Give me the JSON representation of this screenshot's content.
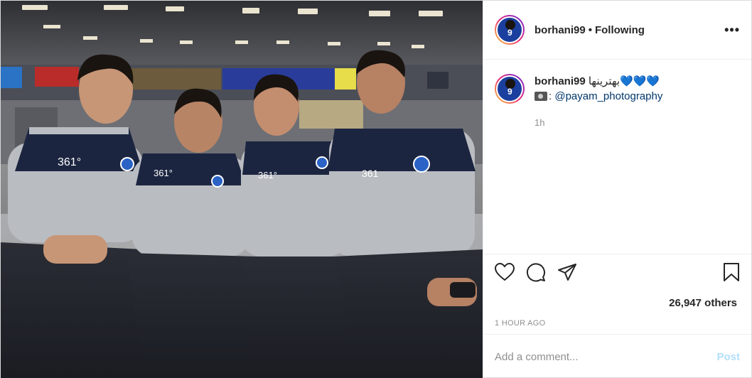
{
  "post": {
    "image_alt": "Four footballers in grey and navy team polo shirts sitting together in an airport terminal"
  },
  "header": {
    "username": "borhani99",
    "separator": "•",
    "follow_status": "Following",
    "more_icon": "more-horizontal-icon"
  },
  "caption": {
    "username": "borhani99",
    "text": "بهترینها",
    "hearts": "💙💙💙",
    "camera_icon": "camera-icon",
    "mention_prefix": ":",
    "mention": "@payam_photography",
    "time": "1h"
  },
  "actions": {
    "like_icon": "heart-icon",
    "comment_icon": "comment-icon",
    "share_icon": "share-icon",
    "save_icon": "bookmark-icon",
    "likes_text": "26,947 others",
    "posted_ago": "1 HOUR AGO"
  },
  "comment_box": {
    "placeholder": "Add a comment...",
    "post_label": "Post"
  },
  "colors": {
    "accent_blue": "#27a7e6",
    "mention_blue": "#00376b",
    "post_button_disabled": "#b2dffc",
    "muted_text": "#8e8e8e",
    "border": "#efefef",
    "jersey_navy": "#1c2540",
    "jersey_grey": "#b9bcc1"
  }
}
